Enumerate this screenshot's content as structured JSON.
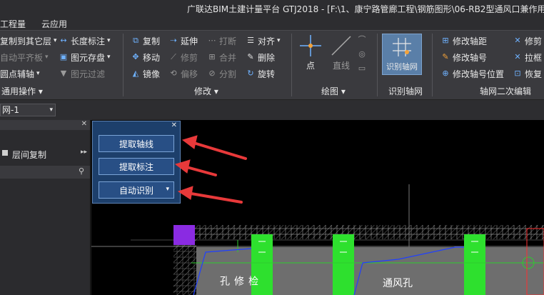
{
  "window": {
    "title": "广联达BIM土建计量平台 GTJ2018 - [F:\\1、康宁路管廊工程\\钢筋图形\\06-RB2型通风口兼作用"
  },
  "menu": {
    "items": [
      "工程量",
      "云应用"
    ]
  },
  "ribbon": {
    "general": {
      "items": [
        "复制到其它层",
        "自动平齐板",
        "圆点辅轴",
        "长度标注",
        "图元存盘",
        "图元过滤"
      ],
      "group_label": "通用操作"
    },
    "modify": {
      "items": [
        "复制",
        "延伸",
        "打断",
        "对齐",
        "移动",
        "修剪",
        "合并",
        "删除",
        "镜像",
        "偏移",
        "分割",
        "旋转"
      ],
      "group_label": "修改"
    },
    "draw": {
      "items": [
        "点",
        "直线"
      ],
      "group_label": "绘图"
    },
    "identify": {
      "button": "识别轴网",
      "group_label": "识别轴网"
    },
    "axis_edit": {
      "items": [
        "修改轴距",
        "修改轴号",
        "修改轴号位置",
        "修剪",
        "拉框",
        "恢复"
      ],
      "group_label": "轴网二次编辑"
    }
  },
  "toolbar": {
    "combo_value": "网-1"
  },
  "left_panel": {
    "row_label": "层间复制"
  },
  "float_panel": {
    "buttons": [
      "提取轴线",
      "提取标注",
      "自动识别"
    ]
  },
  "canvas": {
    "labels": [
      "检修孔",
      "通风孔"
    ]
  },
  "colors": {
    "panel_blue": "#1d3f6b",
    "arrow_red": "#e8393a",
    "green_column": "#2ee02e",
    "purple_block": "#8a2be2"
  }
}
